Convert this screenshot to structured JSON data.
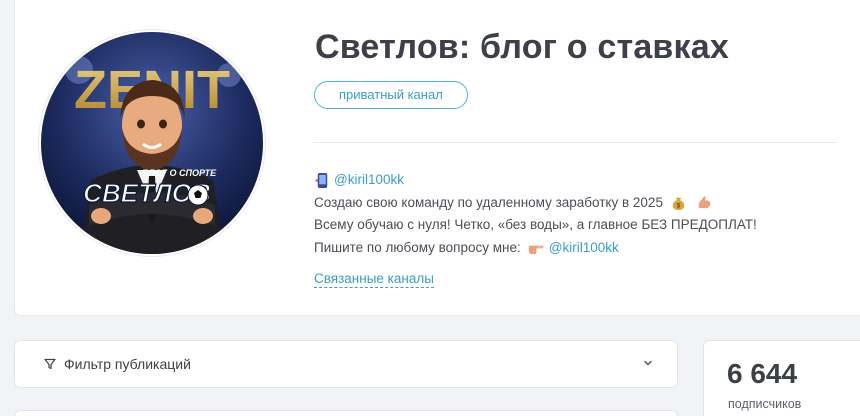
{
  "channel": {
    "title": "Светлов: блог о ставках",
    "badge": "приватный канал",
    "avatar_text": {
      "top": "ZENIT",
      "subtitle": "БЛОГ О СПОРТЕ",
      "name": "СВЕТЛОВ"
    },
    "description": {
      "line1_link": "@kiril100kk",
      "line2": "Создаю свою команду по удаленному заработку в 2025",
      "line3": "Всему обучаю с нуля! Четко, «без воды», а главное БЕЗ ПРЕДОПЛАТ!",
      "line4_text": "Пишите по любому вопросу мне:",
      "line4_link": "@kiril100kk"
    },
    "related_link": "Связанные каналы"
  },
  "filter": {
    "label": "Фильтр публикаций"
  },
  "stats": {
    "subscribers_value": "6 644",
    "subscribers_label": "подписчиков"
  },
  "icons": {
    "line1": "phone-icon",
    "money": "money-bag-icon",
    "muscle": "flexed-biceps-icon",
    "pointer": "pointing-hand-icon",
    "filter": "filter-icon",
    "chevron": "chevron-down-icon"
  },
  "colors": {
    "accent": "#3c9cc3",
    "title": "#3d4147",
    "background": "#f2f3f6"
  }
}
